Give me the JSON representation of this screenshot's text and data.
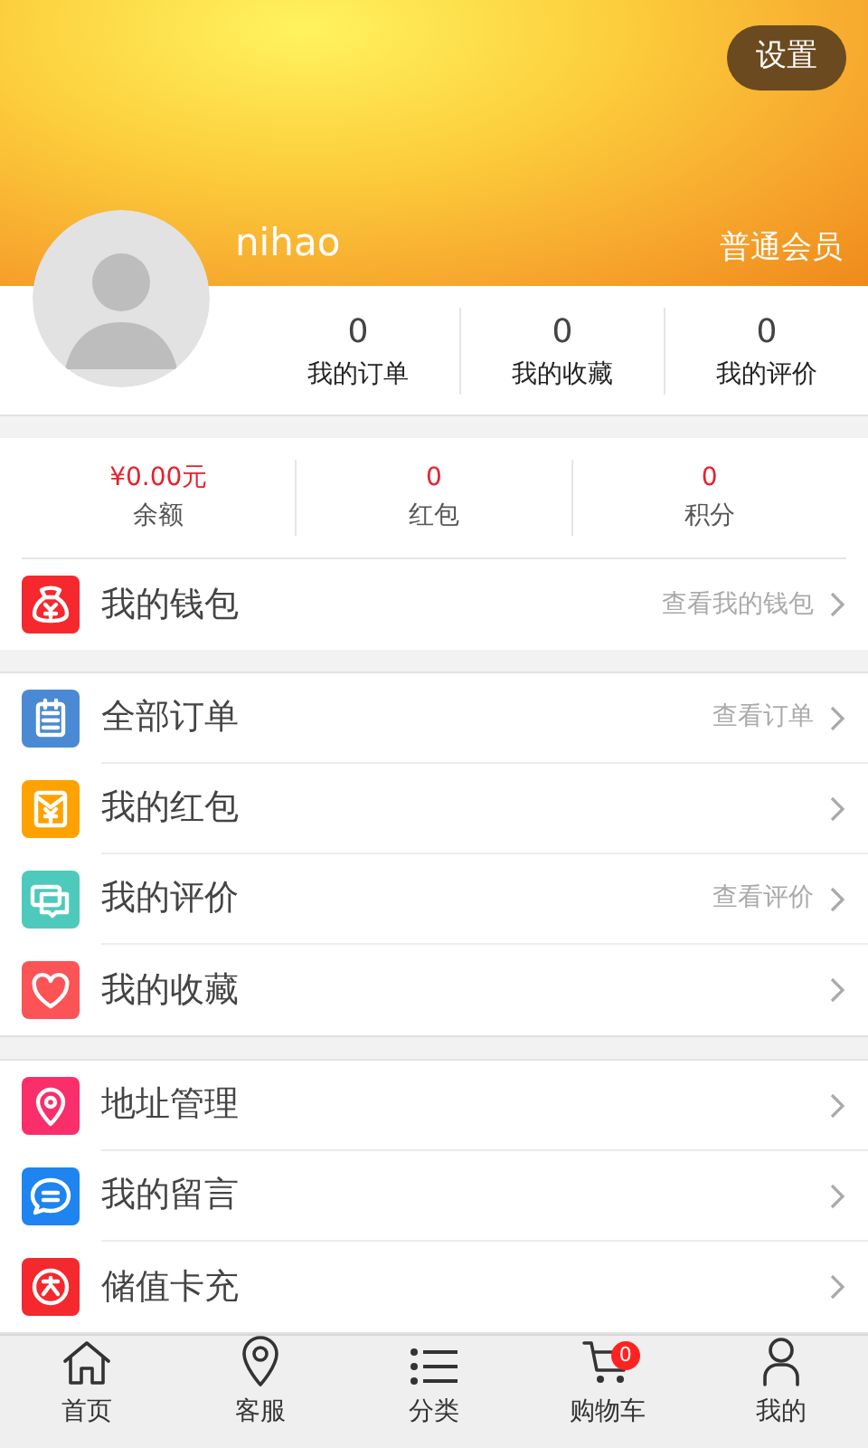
{
  "header": {
    "settings_button": "设置",
    "username": "nihao",
    "member_level": "普通会员"
  },
  "stats": [
    {
      "value": "0",
      "label": "我的订单"
    },
    {
      "value": "0",
      "label": "我的收藏"
    },
    {
      "value": "0",
      "label": "我的评价"
    }
  ],
  "balances": [
    {
      "value": "¥0.00元",
      "label": "余额"
    },
    {
      "value": "0",
      "label": "红包"
    },
    {
      "value": "0",
      "label": "积分"
    }
  ],
  "wallet": {
    "label": "我的钱包",
    "hint": "查看我的钱包",
    "color": "#f5282e"
  },
  "groups": [
    {
      "items": [
        {
          "label": "全部订单",
          "hint": "查看订单",
          "color": "#4a8ad4"
        },
        {
          "label": "我的红包",
          "color": "#fea200"
        },
        {
          "label": "我的评价",
          "hint": "查看评价",
          "color": "#4dcabb"
        },
        {
          "label": "我的收藏",
          "color": "#fb5356"
        }
      ]
    },
    {
      "items": [
        {
          "label": "地址管理",
          "color": "#fa2e6a"
        },
        {
          "label": "我的留言",
          "color": "#1d84f0"
        },
        {
          "label": "储值卡充",
          "color": "#f5282e"
        }
      ]
    }
  ],
  "tab_bar": [
    {
      "label": "首页"
    },
    {
      "label": "客服"
    },
    {
      "label": "分类"
    },
    {
      "label": "购物车",
      "badge": "0"
    },
    {
      "label": "我的"
    }
  ]
}
